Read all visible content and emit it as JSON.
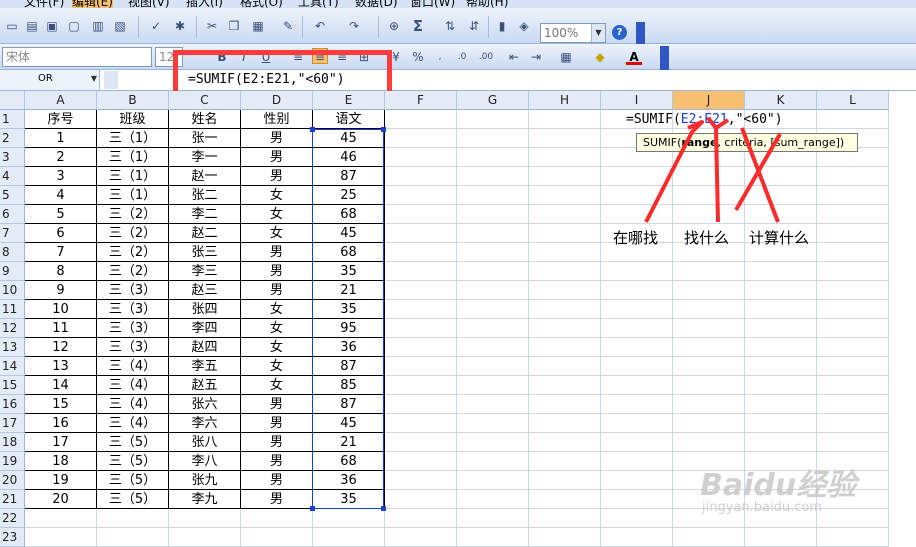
{
  "menu": {
    "items": [
      "文件(F)",
      "编辑(E)",
      "视图(V)",
      "插入(I)",
      "格式(O)",
      "工具(T)",
      "数据(D)",
      "窗口(W)",
      "帮助(H)"
    ]
  },
  "toolbar": {
    "zoom": "100%",
    "font_name": "宋体",
    "font_size": "12"
  },
  "formula_bar": {
    "name_box": "OR",
    "formula": "=SUMIF(E2:E21,\"<60\")"
  },
  "columns": [
    "A",
    "B",
    "C",
    "D",
    "E",
    "F",
    "G",
    "H",
    "I",
    "J",
    "K",
    "L"
  ],
  "rows": [
    "1",
    "2",
    "3",
    "4",
    "5",
    "6",
    "7",
    "8",
    "9",
    "10",
    "11",
    "12",
    "13",
    "14",
    "15",
    "16",
    "17",
    "18",
    "19",
    "20",
    "21",
    "22",
    "23"
  ],
  "headers": [
    "序号",
    "班级",
    "姓名",
    "性别",
    "语文"
  ],
  "table_rows": [
    [
      "1",
      "三（1）",
      "张一",
      "男",
      "45"
    ],
    [
      "2",
      "三（1）",
      "李一",
      "男",
      "46"
    ],
    [
      "3",
      "三（1）",
      "赵一",
      "男",
      "87"
    ],
    [
      "4",
      "三（1）",
      "张二",
      "女",
      "25"
    ],
    [
      "5",
      "三（2）",
      "李二",
      "女",
      "68"
    ],
    [
      "6",
      "三（2）",
      "赵二",
      "女",
      "45"
    ],
    [
      "7",
      "三（2）",
      "张三",
      "男",
      "68"
    ],
    [
      "8",
      "三（2）",
      "李三",
      "男",
      "35"
    ],
    [
      "9",
      "三（3）",
      "赵三",
      "男",
      "21"
    ],
    [
      "10",
      "三（3）",
      "张四",
      "女",
      "35"
    ],
    [
      "11",
      "三（3）",
      "李四",
      "女",
      "95"
    ],
    [
      "12",
      "三（3）",
      "赵四",
      "女",
      "36"
    ],
    [
      "13",
      "三（4）",
      "李五",
      "女",
      "87"
    ],
    [
      "14",
      "三（4）",
      "赵五",
      "女",
      "85"
    ],
    [
      "15",
      "三（4）",
      "张六",
      "男",
      "87"
    ],
    [
      "16",
      "三（4）",
      "李六",
      "男",
      "45"
    ],
    [
      "17",
      "三（5）",
      "张八",
      "男",
      "21"
    ],
    [
      "18",
      "三（5）",
      "李八",
      "男",
      "68"
    ],
    [
      "19",
      "三（5）",
      "张九",
      "男",
      "36"
    ],
    [
      "20",
      "三（5）",
      "李九",
      "男",
      "35"
    ]
  ],
  "editing_cell": {
    "prefix": "=SUMIF(",
    "ref": "E2:E21",
    "suffix": ",\"<60\")"
  },
  "tooltip": {
    "fn": "SUMIF(",
    "active": "range",
    "rest": ", criteria, [sum_range])"
  },
  "annotations": {
    "where": "在哪找",
    "what": "找什么",
    "calc": "计算什么"
  },
  "watermark": {
    "logo": "Baidu经验",
    "url": "jingyan.baidu.com"
  },
  "colors": {
    "selection": "#1a3fd6",
    "highlight_box": "#ff3b3b",
    "active_column": "#f9c16f"
  }
}
